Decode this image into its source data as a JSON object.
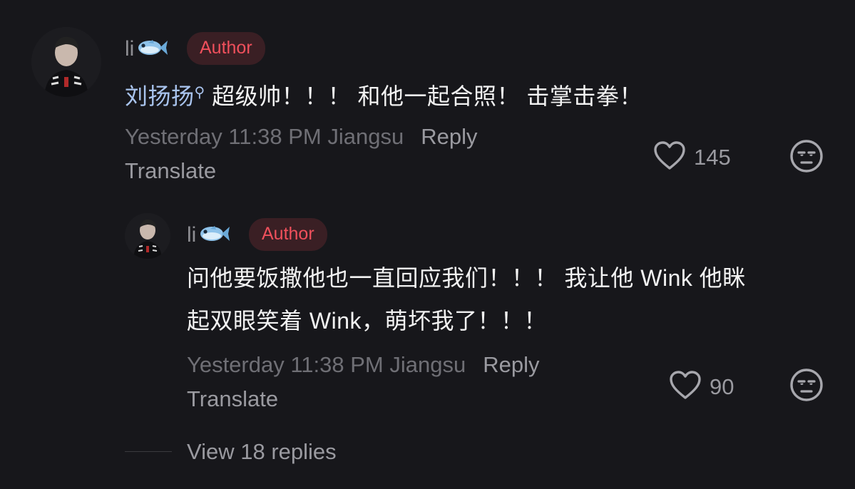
{
  "comments": [
    {
      "username": "li",
      "badge": "Author",
      "mention": "刘扬扬",
      "text": " 超级帅！！！ 和他一起合照！ 击掌击拳！",
      "timestamp": "Yesterday 11:38 PM Jiangsu",
      "reply_label": "Reply",
      "translate_label": "Translate",
      "likes": "145"
    }
  ],
  "replies": [
    {
      "username": "li",
      "badge": "Author",
      "text_line1": "问他要饭撒他也一直回应我们！！！ 我让他 Wink 他眯",
      "text_line2": "起双眼笑着 Wink，萌坏我了！！！",
      "timestamp": "Yesterday 11:38 PM Jiangsu",
      "reply_label": "Reply",
      "translate_label": "Translate",
      "likes": "90"
    }
  ],
  "view_replies_label": "View 18 replies",
  "icons": {
    "like": "heart-outline-icon",
    "dislike": "unamused-face-icon",
    "fish": "fish-emoji-icon",
    "search": "search-mention-icon"
  },
  "colors": {
    "background": "#17171b",
    "badge_bg": "#3a1f24",
    "badge_text": "#f0505c",
    "mention": "#a9c4ee"
  }
}
